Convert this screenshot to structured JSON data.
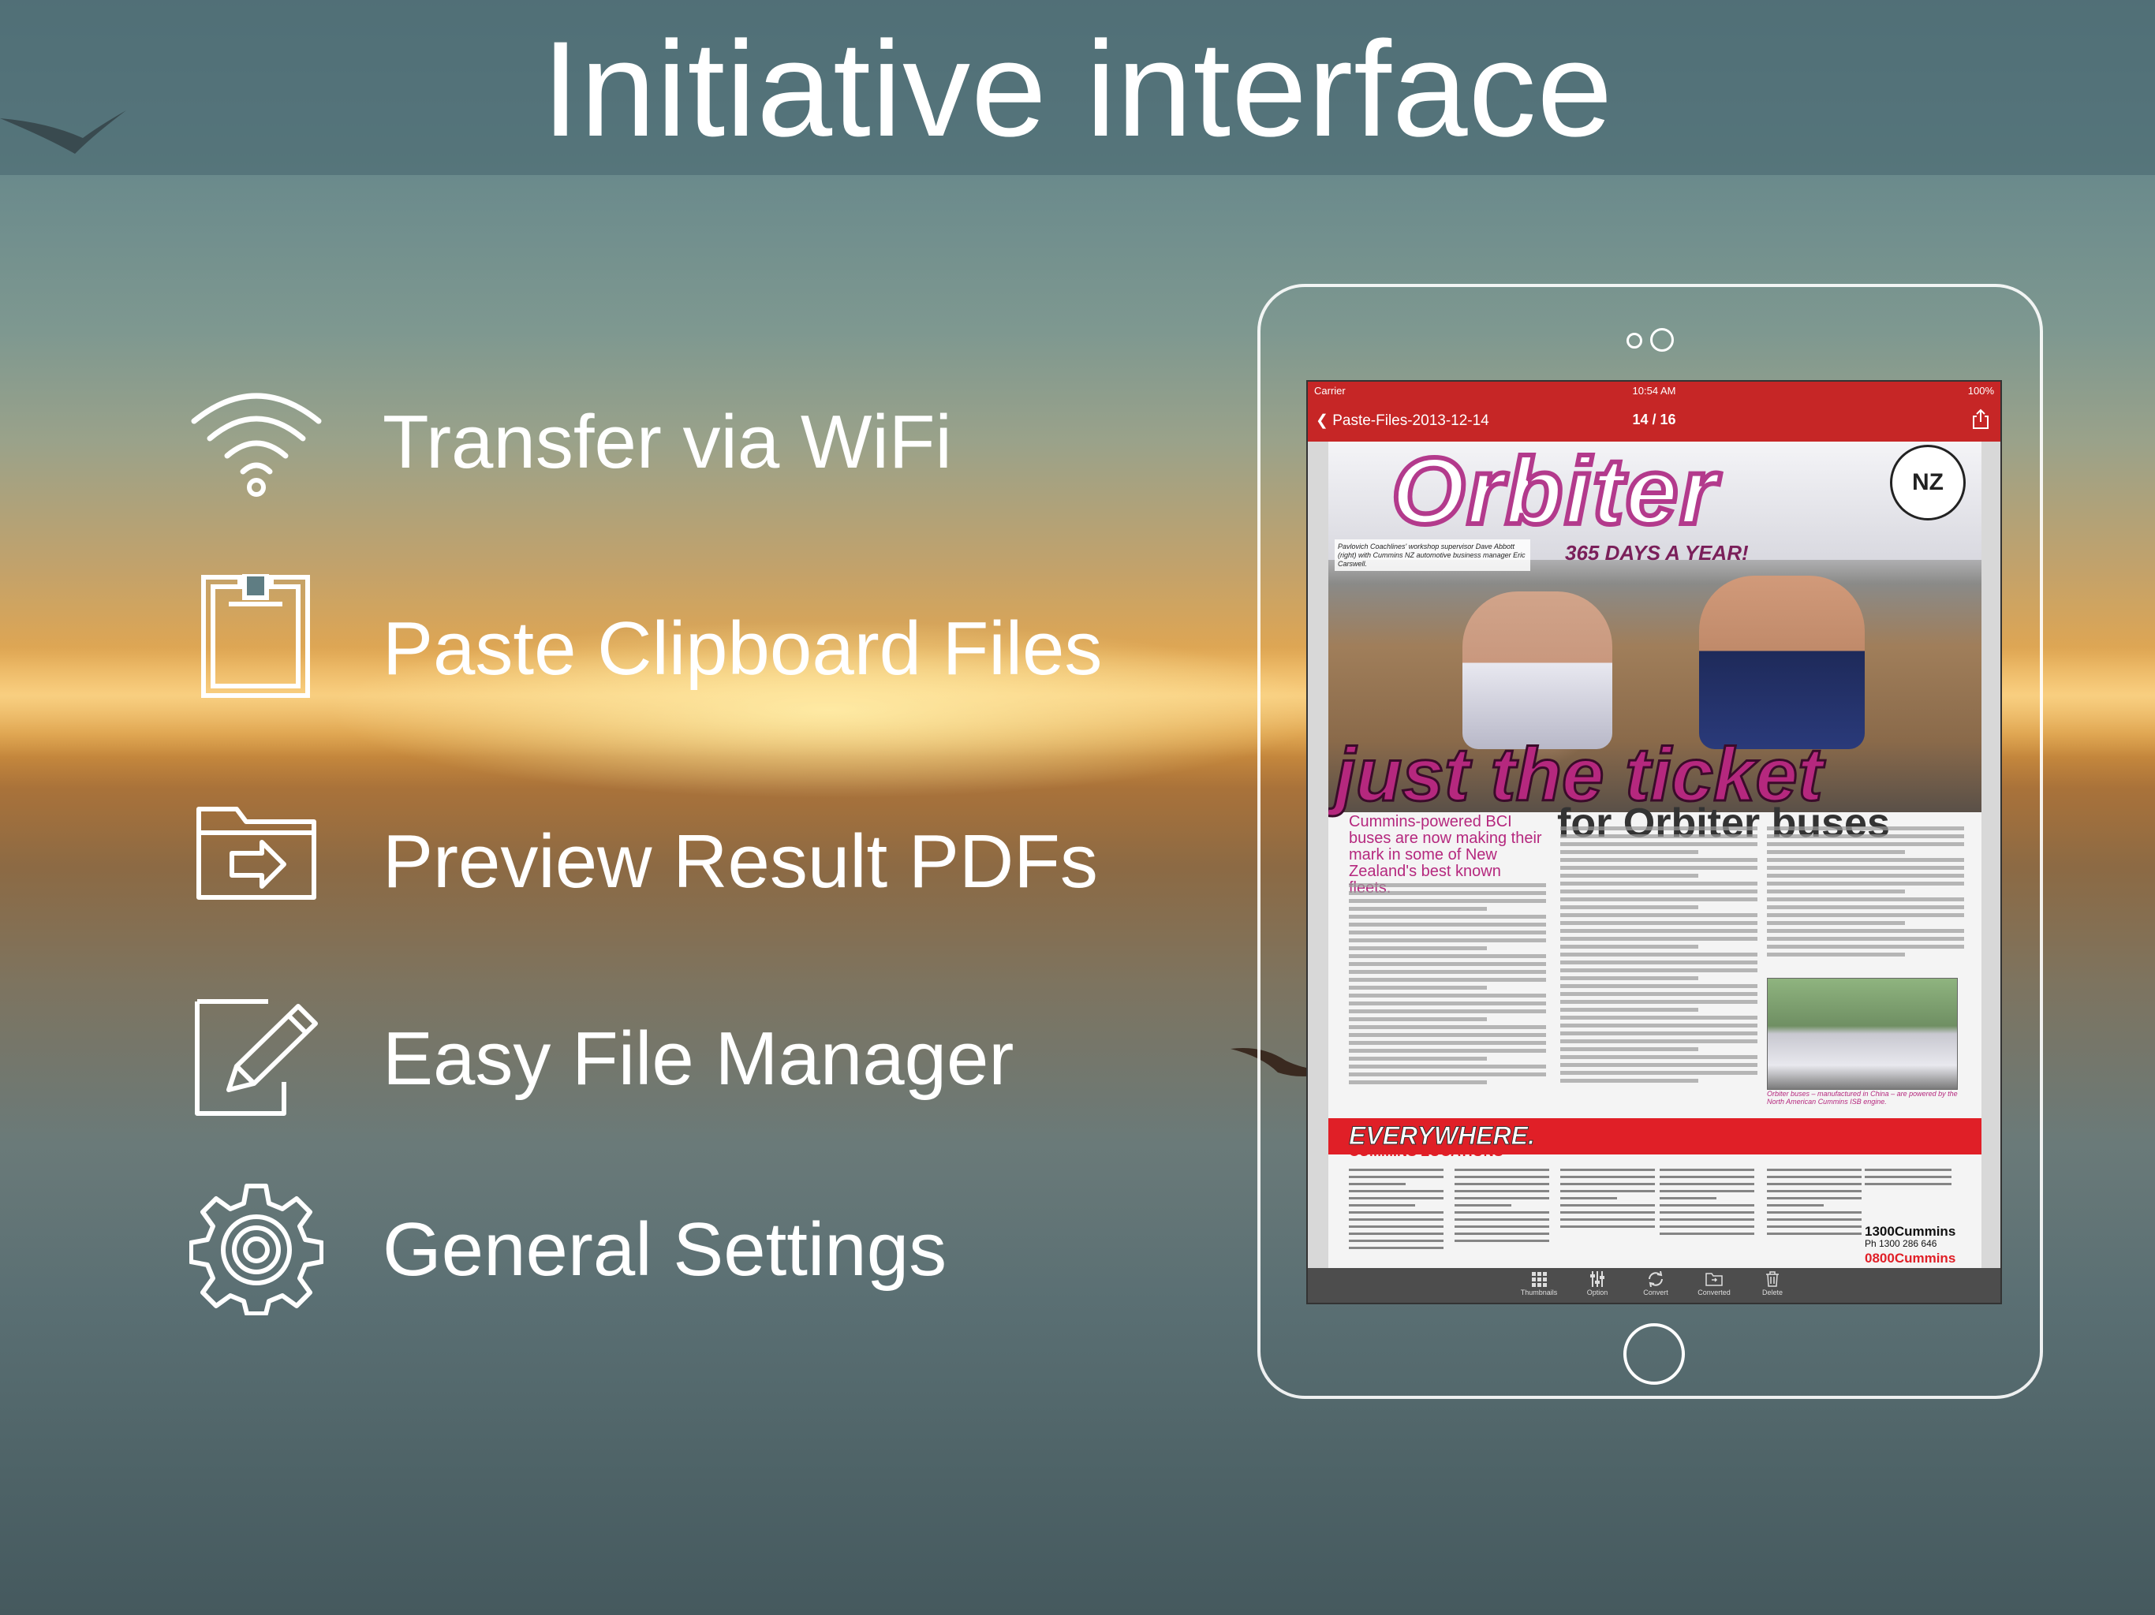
{
  "header": {
    "title": "Initiative interface"
  },
  "features": [
    {
      "label": "Transfer via WiFi",
      "icon": "wifi-icon"
    },
    {
      "label": "Paste Clipboard Files",
      "icon": "clipboard-icon"
    },
    {
      "label": "Preview Result PDFs",
      "icon": "folder-export-icon"
    },
    {
      "label": "Easy File Manager",
      "icon": "edit-pencil-icon"
    },
    {
      "label": "General Settings",
      "icon": "gear-icon"
    }
  ],
  "device": {
    "status": {
      "carrier": "Carrier",
      "time": "10:54 AM",
      "battery": "100%"
    },
    "nav": {
      "back_label": "Paste-Files-2013-12-14",
      "page_indicator": "14 / 16"
    },
    "pdf": {
      "brand": "Orbiter",
      "tagline": "365 DAYS A YEAR!",
      "badge": "NZ",
      "photo_caption": "Pavlovich Coachlines' workshop supervisor Dave Abbott (right) with Cummins NZ automotive business manager Eric Carswell.",
      "headline": "just the ticket",
      "subheadline": "for Orbiter buses",
      "lede": "Cummins-powered BCI buses are now making their mark in some of New Zealand's best known fleets.",
      "inset_caption": "Orbiter buses – manufactured in China – are powered by the North American Cummins ISB engine.",
      "banner_title": "EVERYWHERE.",
      "banner_subtitle": "CUMMINS LOCATIONS",
      "contact_au": "1300Cummins",
      "contact_au_phone": "Ph 1300 286 646",
      "contact_nz": "0800Cummins"
    },
    "toolbar": [
      {
        "label": "Thumbnails",
        "icon": "grid-icon"
      },
      {
        "label": "Option",
        "icon": "sliders-icon"
      },
      {
        "label": "Convert",
        "icon": "refresh-icon"
      },
      {
        "label": "Converted",
        "icon": "folder-icon"
      },
      {
        "label": "Delete",
        "icon": "trash-icon"
      }
    ]
  }
}
